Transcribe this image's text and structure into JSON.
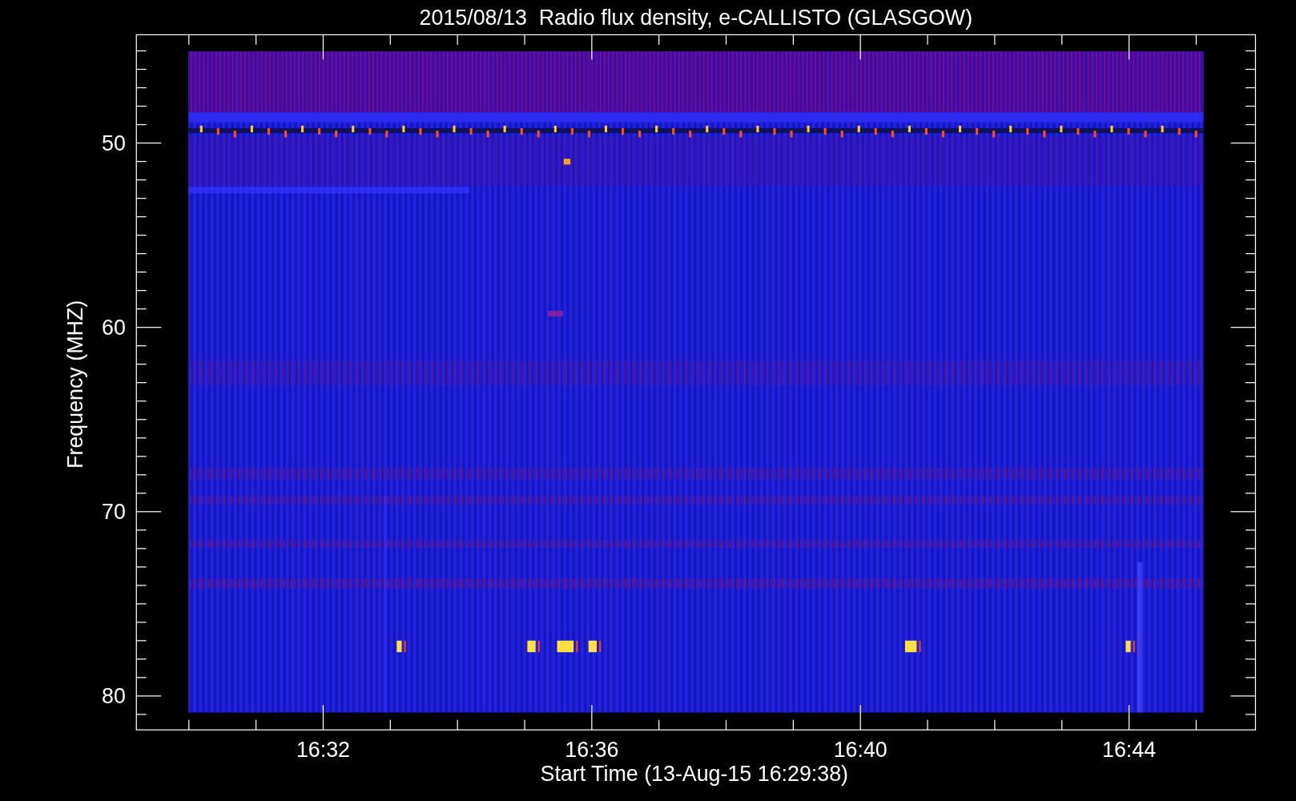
{
  "title": "2015/08/13  Radio flux density, e-CALLISTO (GLASGOW)",
  "ylabel": "Frequency (MHZ)",
  "xlabel": "Start Time (13-Aug-15 16:29:38)",
  "yticks": [
    "50",
    "60",
    "70",
    "80"
  ],
  "xticks": [
    "16:32",
    "16:36",
    "16:40",
    "16:44"
  ]
}
